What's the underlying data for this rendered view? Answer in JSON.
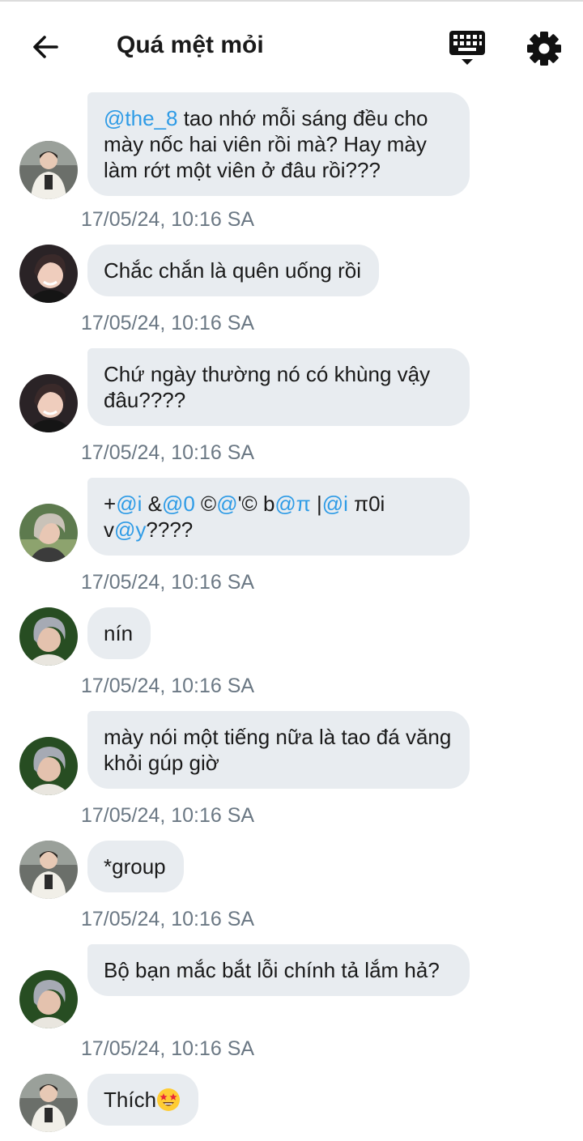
{
  "header": {
    "title": "Quá mệt mỏi",
    "back_icon": "arrow-left-icon",
    "keyboard_icon": "keyboard-icon",
    "settings_icon": "gear-icon"
  },
  "messages": [
    {
      "avatar": "avatar-person-a",
      "parts": [
        {
          "type": "mention",
          "text": "@the_8"
        },
        {
          "type": "text",
          "text": " tao nhớ mỗi sáng đều cho mày nốc hai viên rồi mà? Hay mày làm rớt một viên ở đâu rồi???"
        }
      ],
      "time": "17/05/24, 10:16 SA"
    },
    {
      "avatar": "avatar-person-b",
      "parts": [
        {
          "type": "text",
          "text": "Chắc chắn là quên uống rồi"
        }
      ],
      "time": "17/05/24, 10:16 SA"
    },
    {
      "avatar": "avatar-person-b",
      "parts": [
        {
          "type": "text",
          "text": "Chứ ngày thường nó có khùng vậy đâu????"
        }
      ],
      "time": "17/05/24, 10:16 SA"
    },
    {
      "avatar": "avatar-person-c",
      "parts": [
        {
          "type": "text",
          "text": "+"
        },
        {
          "type": "mention",
          "text": "@i"
        },
        {
          "type": "text",
          "text": " &"
        },
        {
          "type": "mention",
          "text": "@0"
        },
        {
          "type": "text",
          "text": " ©"
        },
        {
          "type": "mention",
          "text": "@"
        },
        {
          "type": "text",
          "text": "'© b"
        },
        {
          "type": "mention",
          "text": "@π"
        },
        {
          "type": "text",
          "text": " |"
        },
        {
          "type": "mention",
          "text": "@i"
        },
        {
          "type": "text",
          "text": " π0i v"
        },
        {
          "type": "mention",
          "text": "@y"
        },
        {
          "type": "text",
          "text": "????"
        }
      ],
      "time": "17/05/24, 10:16 SA"
    },
    {
      "avatar": "avatar-person-d",
      "parts": [
        {
          "type": "text",
          "text": "nín"
        }
      ],
      "time": "17/05/24, 10:16 SA"
    },
    {
      "avatar": "avatar-person-d",
      "parts": [
        {
          "type": "text",
          "text": "mày nói một tiếng nữa là tao đá văng khỏi gúp giờ"
        }
      ],
      "time": "17/05/24, 10:16 SA"
    },
    {
      "avatar": "avatar-person-a",
      "parts": [
        {
          "type": "text",
          "text": "*group"
        }
      ],
      "time": "17/05/24, 10:16 SA"
    },
    {
      "avatar": "avatar-person-d",
      "parts": [
        {
          "type": "text",
          "text": "Bộ bạn mắc bắt lỗi chính tả lắm hả?"
        }
      ],
      "time": "17/05/24, 10:16 SA"
    },
    {
      "avatar": "avatar-person-a",
      "parts": [
        {
          "type": "text",
          "text": "Thích"
        },
        {
          "type": "emoji",
          "text": "star-struck-emoji"
        }
      ],
      "time": ""
    }
  ],
  "colors": {
    "bubble": "#e8ecf0",
    "mention": "#2e9be6",
    "timestamp": "#6b7884",
    "title": "#1a1a1a"
  }
}
